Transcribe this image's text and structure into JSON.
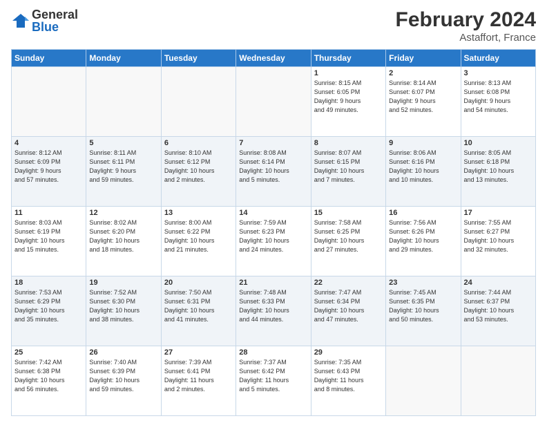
{
  "logo": {
    "general": "General",
    "blue": "Blue"
  },
  "header": {
    "month_year": "February 2024",
    "location": "Astaffort, France"
  },
  "weekdays": [
    "Sunday",
    "Monday",
    "Tuesday",
    "Wednesday",
    "Thursday",
    "Friday",
    "Saturday"
  ],
  "weeks": [
    [
      {
        "day": "",
        "info": ""
      },
      {
        "day": "",
        "info": ""
      },
      {
        "day": "",
        "info": ""
      },
      {
        "day": "",
        "info": ""
      },
      {
        "day": "1",
        "info": "Sunrise: 8:15 AM\nSunset: 6:05 PM\nDaylight: 9 hours\nand 49 minutes."
      },
      {
        "day": "2",
        "info": "Sunrise: 8:14 AM\nSunset: 6:07 PM\nDaylight: 9 hours\nand 52 minutes."
      },
      {
        "day": "3",
        "info": "Sunrise: 8:13 AM\nSunset: 6:08 PM\nDaylight: 9 hours\nand 54 minutes."
      }
    ],
    [
      {
        "day": "4",
        "info": "Sunrise: 8:12 AM\nSunset: 6:09 PM\nDaylight: 9 hours\nand 57 minutes."
      },
      {
        "day": "5",
        "info": "Sunrise: 8:11 AM\nSunset: 6:11 PM\nDaylight: 9 hours\nand 59 minutes."
      },
      {
        "day": "6",
        "info": "Sunrise: 8:10 AM\nSunset: 6:12 PM\nDaylight: 10 hours\nand 2 minutes."
      },
      {
        "day": "7",
        "info": "Sunrise: 8:08 AM\nSunset: 6:14 PM\nDaylight: 10 hours\nand 5 minutes."
      },
      {
        "day": "8",
        "info": "Sunrise: 8:07 AM\nSunset: 6:15 PM\nDaylight: 10 hours\nand 7 minutes."
      },
      {
        "day": "9",
        "info": "Sunrise: 8:06 AM\nSunset: 6:16 PM\nDaylight: 10 hours\nand 10 minutes."
      },
      {
        "day": "10",
        "info": "Sunrise: 8:05 AM\nSunset: 6:18 PM\nDaylight: 10 hours\nand 13 minutes."
      }
    ],
    [
      {
        "day": "11",
        "info": "Sunrise: 8:03 AM\nSunset: 6:19 PM\nDaylight: 10 hours\nand 15 minutes."
      },
      {
        "day": "12",
        "info": "Sunrise: 8:02 AM\nSunset: 6:20 PM\nDaylight: 10 hours\nand 18 minutes."
      },
      {
        "day": "13",
        "info": "Sunrise: 8:00 AM\nSunset: 6:22 PM\nDaylight: 10 hours\nand 21 minutes."
      },
      {
        "day": "14",
        "info": "Sunrise: 7:59 AM\nSunset: 6:23 PM\nDaylight: 10 hours\nand 24 minutes."
      },
      {
        "day": "15",
        "info": "Sunrise: 7:58 AM\nSunset: 6:25 PM\nDaylight: 10 hours\nand 27 minutes."
      },
      {
        "day": "16",
        "info": "Sunrise: 7:56 AM\nSunset: 6:26 PM\nDaylight: 10 hours\nand 29 minutes."
      },
      {
        "day": "17",
        "info": "Sunrise: 7:55 AM\nSunset: 6:27 PM\nDaylight: 10 hours\nand 32 minutes."
      }
    ],
    [
      {
        "day": "18",
        "info": "Sunrise: 7:53 AM\nSunset: 6:29 PM\nDaylight: 10 hours\nand 35 minutes."
      },
      {
        "day": "19",
        "info": "Sunrise: 7:52 AM\nSunset: 6:30 PM\nDaylight: 10 hours\nand 38 minutes."
      },
      {
        "day": "20",
        "info": "Sunrise: 7:50 AM\nSunset: 6:31 PM\nDaylight: 10 hours\nand 41 minutes."
      },
      {
        "day": "21",
        "info": "Sunrise: 7:48 AM\nSunset: 6:33 PM\nDaylight: 10 hours\nand 44 minutes."
      },
      {
        "day": "22",
        "info": "Sunrise: 7:47 AM\nSunset: 6:34 PM\nDaylight: 10 hours\nand 47 minutes."
      },
      {
        "day": "23",
        "info": "Sunrise: 7:45 AM\nSunset: 6:35 PM\nDaylight: 10 hours\nand 50 minutes."
      },
      {
        "day": "24",
        "info": "Sunrise: 7:44 AM\nSunset: 6:37 PM\nDaylight: 10 hours\nand 53 minutes."
      }
    ],
    [
      {
        "day": "25",
        "info": "Sunrise: 7:42 AM\nSunset: 6:38 PM\nDaylight: 10 hours\nand 56 minutes."
      },
      {
        "day": "26",
        "info": "Sunrise: 7:40 AM\nSunset: 6:39 PM\nDaylight: 10 hours\nand 59 minutes."
      },
      {
        "day": "27",
        "info": "Sunrise: 7:39 AM\nSunset: 6:41 PM\nDaylight: 11 hours\nand 2 minutes."
      },
      {
        "day": "28",
        "info": "Sunrise: 7:37 AM\nSunset: 6:42 PM\nDaylight: 11 hours\nand 5 minutes."
      },
      {
        "day": "29",
        "info": "Sunrise: 7:35 AM\nSunset: 6:43 PM\nDaylight: 11 hours\nand 8 minutes."
      },
      {
        "day": "",
        "info": ""
      },
      {
        "day": "",
        "info": ""
      }
    ]
  ]
}
